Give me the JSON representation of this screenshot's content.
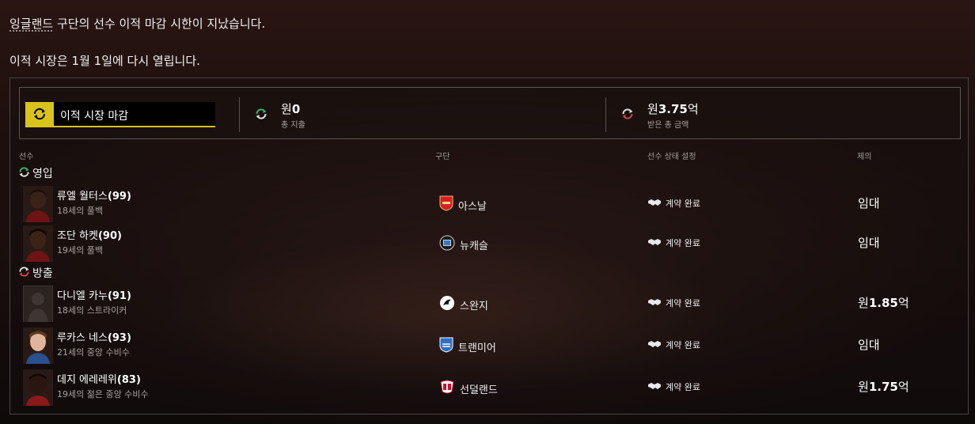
{
  "notice": {
    "line1_club": "잉글랜드",
    "line1_rest": " 구단의 선수 이적 마감 시한이 지났습니다.",
    "line2": "이적 시장은 1월 1일에 다시 열립니다."
  },
  "summary": {
    "deadline_label": "이적 시장 마감",
    "spent": {
      "prefix": "원",
      "amount": "0",
      "label": "총 지출"
    },
    "received": {
      "prefix": "원",
      "amount": "3.75",
      "suffix": "억",
      "label": "받은 총 금액"
    }
  },
  "columns": {
    "player": "선수",
    "club": "구단",
    "status": "선수 상태 설정",
    "offer": "제의"
  },
  "sections": {
    "incoming": "영입",
    "outgoing": "방출"
  },
  "incoming": [
    {
      "name": "류엘 월터스",
      "rating": "(99)",
      "desc": "18세의 풀백",
      "club": "아스날",
      "club_icon": "arsenal-crest-icon",
      "status": "계약 완료",
      "offer_plain": "임대",
      "offer_prefix": "",
      "offer_bold": "",
      "offer_suffix": ""
    },
    {
      "name": "조단 하켓",
      "rating": "(90)",
      "desc": "19세의 풀백",
      "club": "뉴캐슬",
      "club_icon": "newcastle-crest-icon",
      "status": "계약 완료",
      "offer_plain": "임대",
      "offer_prefix": "",
      "offer_bold": "",
      "offer_suffix": ""
    }
  ],
  "outgoing": [
    {
      "name": "다니엘 카누",
      "rating": "(91)",
      "desc": "18세의 스트라이커",
      "club": "스완지",
      "club_icon": "swansea-crest-icon",
      "status": "계약 완료",
      "offer_plain": "",
      "offer_prefix": "원",
      "offer_bold": "1.85",
      "offer_suffix": "억"
    },
    {
      "name": "루카스 네스",
      "rating": "(93)",
      "desc": "21세의 중앙 수비수",
      "club": "트랜미어",
      "club_icon": "tranmere-crest-icon",
      "status": "계약 완료",
      "offer_plain": "임대",
      "offer_prefix": "",
      "offer_bold": "",
      "offer_suffix": ""
    },
    {
      "name": "데지 에레레위",
      "rating": "(83)",
      "desc": "19세의 젊은 중앙 수비수",
      "club": "선덜랜드",
      "club_icon": "sunderland-crest-icon",
      "status": "계약 완료",
      "offer_plain": "",
      "offer_prefix": "원",
      "offer_bold": "1.75",
      "offer_suffix": "억"
    }
  ],
  "colors": {
    "accent_yellow": "#d9c21c",
    "incoming_green": "#3fb37a",
    "outgoing_red": "#d9434a"
  }
}
